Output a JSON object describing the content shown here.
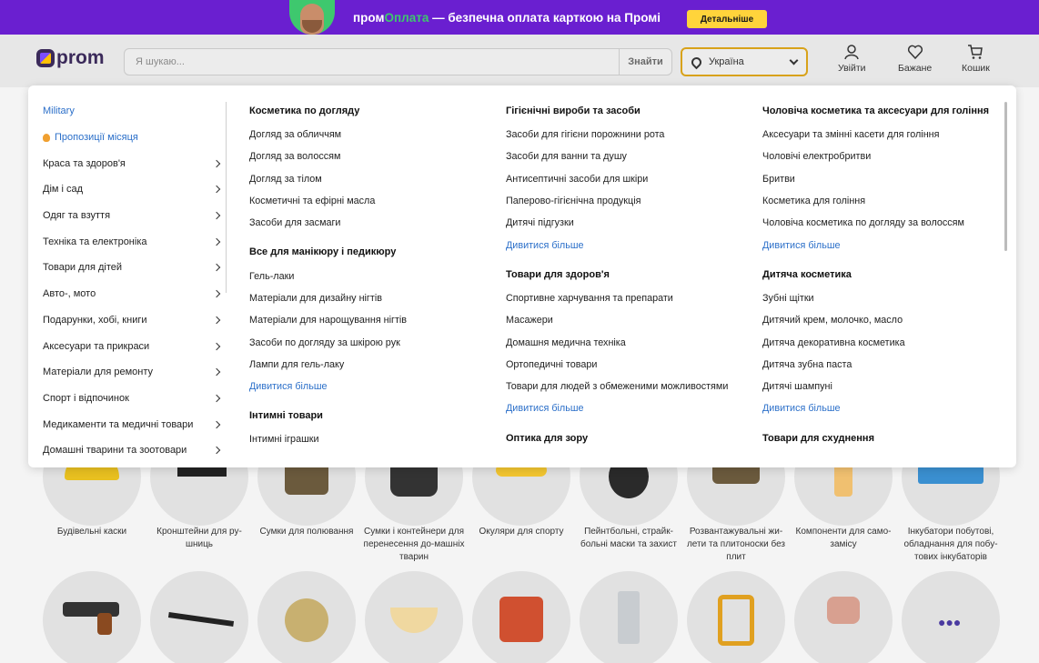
{
  "promo": {
    "brand_part1": "пром",
    "brand_part2": "Оплата",
    "text": " — безпечна оплата карткою на Промі",
    "button": "Детальніше"
  },
  "header": {
    "logo": "prom",
    "search_placeholder": "Я шукаю...",
    "search_button": "Знайти",
    "region": "Україна",
    "actions": {
      "login": "Увійти",
      "wishlist": "Бажане",
      "cart": "Кошик"
    }
  },
  "sidebar": {
    "items": [
      {
        "label": "Military"
      },
      {
        "label": "Пропозиції місяця"
      },
      {
        "label": "Краса та здоров'я"
      },
      {
        "label": "Дім і сад"
      },
      {
        "label": "Одяг та взуття"
      },
      {
        "label": "Техніка та електроніка"
      },
      {
        "label": "Товари для дітей"
      },
      {
        "label": "Авто-, мото"
      },
      {
        "label": "Подарунки, хобі, книги"
      },
      {
        "label": "Аксесуари та прикраси"
      },
      {
        "label": "Матеріали для ремонту"
      },
      {
        "label": "Спорт і відпочинок"
      },
      {
        "label": "Медикаменти та медичні товари"
      },
      {
        "label": "Домашні тварини та зоотовари"
      }
    ]
  },
  "columns": [
    {
      "groups": [
        {
          "title": "Косметика по догляду",
          "links": [
            "Догляд за обличчям",
            "Догляд за волоссям",
            "Догляд за тілом",
            "Косметичні та ефірні масла",
            "Засоби для засмаги"
          ]
        },
        {
          "title": "Все для манікюру і педикюру",
          "links": [
            "Гель-лаки",
            "Матеріали для дизайну нігтів",
            "Матеріали для нарощування нігтів",
            "Засоби по догляду за шкірою рук",
            "Лампи для гель-лаку"
          ],
          "more": "Дивитися більше"
        },
        {
          "title": "Інтимні товари",
          "links": [
            "Інтимні іграшки"
          ]
        }
      ]
    },
    {
      "groups": [
        {
          "title": "Гігієнічні вироби та засоби",
          "links": [
            "Засоби для гігієни порожнини рота",
            "Засоби для ванни та душу",
            "Антисептичні засоби для шкіри",
            "Паперово-гігієнічна продукція",
            "Дитячі підгузки"
          ],
          "more": "Дивитися більше"
        },
        {
          "title": "Товари для здоров'я",
          "links": [
            "Спортивне харчування та препарати",
            "Масажери",
            "Домашня медична техніка",
            "Ортопедичні товари",
            "Товари для людей з обмеженими можливостями"
          ],
          "more": "Дивитися більше"
        },
        {
          "title": "Оптика для зору",
          "links": []
        }
      ]
    },
    {
      "groups": [
        {
          "title": "Чоловіча косметика та аксесуари для гоління",
          "links": [
            "Аксесуари та змінні касети для гоління",
            "Чоловічі електробритви",
            "Бритви",
            "Косметика для гоління",
            "Чоловіча косметика по догляду за волоссям"
          ],
          "more": "Дивитися більше"
        },
        {
          "title": "Дитяча косметика",
          "links": [
            "Зубні щітки",
            "Дитячий крем, молочко, масло",
            "Дитяча декоративна косметика",
            "Дитяча зубна паста",
            "Дитячі шампуні"
          ],
          "more": "Дивитися більше"
        },
        {
          "title": "Товари для схуднення",
          "links": []
        }
      ]
    }
  ],
  "background_categories": [
    {
      "label": "Будівельні каски"
    },
    {
      "label": "Кронштейни для ру-шниць"
    },
    {
      "label": "Сумки для полювання"
    },
    {
      "label": "Сумки і контейнери для перенесення до-машніх тварин"
    },
    {
      "label": "Окуляри для спорту"
    },
    {
      "label": "Пейнтбольні, страйк-больні маски та захист"
    },
    {
      "label": "Розвантажувальні жи-лети та плитоноски без плит"
    },
    {
      "label": "Компоненти для само-замісу"
    },
    {
      "label": "Інкубатори побутові, обладнання для побу-тових інкубаторів"
    }
  ],
  "colors": {
    "promo_bg": "#6a1fd0",
    "accent_green": "#3ec86e",
    "accent_yellow": "#ffd43b",
    "link_blue": "#2b6fc9"
  }
}
